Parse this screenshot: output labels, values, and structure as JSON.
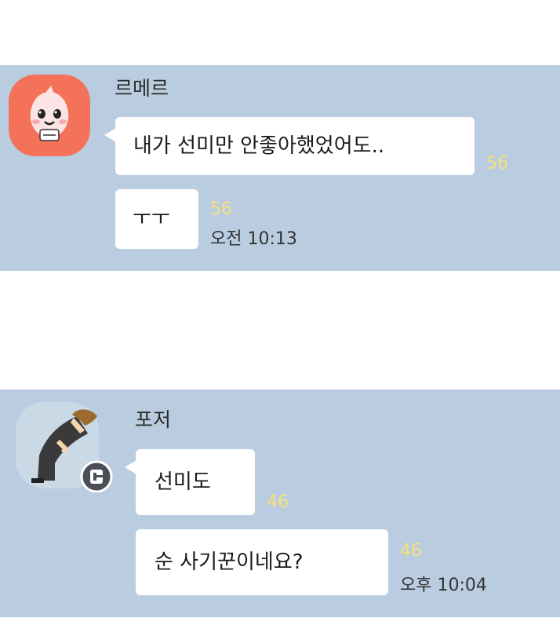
{
  "chat1": {
    "sender": "르메르",
    "messages": [
      {
        "text": "내가 선미만 안좋아했었어도..",
        "unread": "56"
      },
      {
        "text": "ㅜㅜ",
        "unread": "56",
        "time": "오전 10:13"
      }
    ]
  },
  "chat2": {
    "sender": "포저",
    "messages": [
      {
        "text": "선미도",
        "unread": "46"
      },
      {
        "text": "순 사기꾼이네요?",
        "unread": "46",
        "time": "오후 10:04"
      }
    ]
  },
  "colors": {
    "panel": "#bacde0",
    "unread": "#f5e07a",
    "bubble": "#ffffff"
  }
}
